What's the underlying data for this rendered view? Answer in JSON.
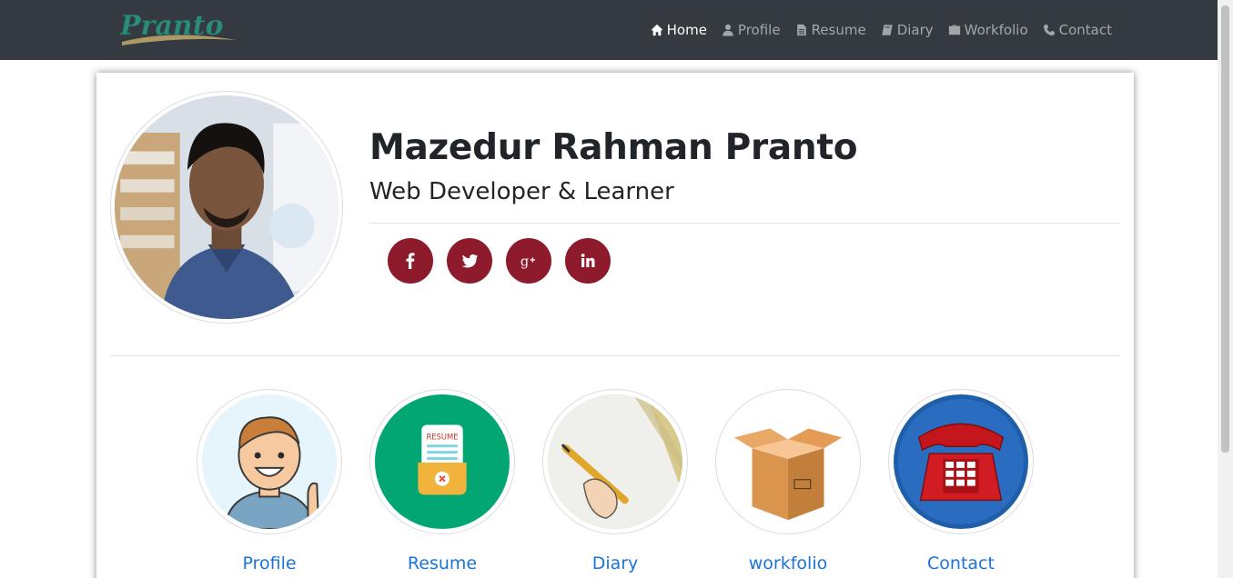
{
  "navbar": {
    "brand": "Pranto",
    "items": [
      {
        "label": "Home",
        "icon": "home-icon",
        "active": true
      },
      {
        "label": "Profile",
        "icon": "user-icon"
      },
      {
        "label": "Resume",
        "icon": "file-icon"
      },
      {
        "label": "Diary",
        "icon": "book-icon"
      },
      {
        "label": "Workfolio",
        "icon": "briefcase-icon"
      },
      {
        "label": "Contact",
        "icon": "phone-icon"
      }
    ]
  },
  "profile": {
    "name": "Mazedur Rahman Pranto",
    "tagline": "Web Developer & Learner"
  },
  "socials": [
    "facebook-icon",
    "twitter-icon",
    "google-plus-icon",
    "linkedin-icon"
  ],
  "tiles": [
    {
      "label": "Profile"
    },
    {
      "label": "Resume"
    },
    {
      "label": "Diary"
    },
    {
      "label": "workfolio"
    },
    {
      "label": "Contact"
    }
  ],
  "resume_badge": "RESUME",
  "colors": {
    "navbar_bg": "#343a40",
    "social_bg": "#8e1b2c",
    "link": "#1a73d9",
    "resume_bg": "#02a673",
    "contact_bg": "#1f5ea8"
  }
}
